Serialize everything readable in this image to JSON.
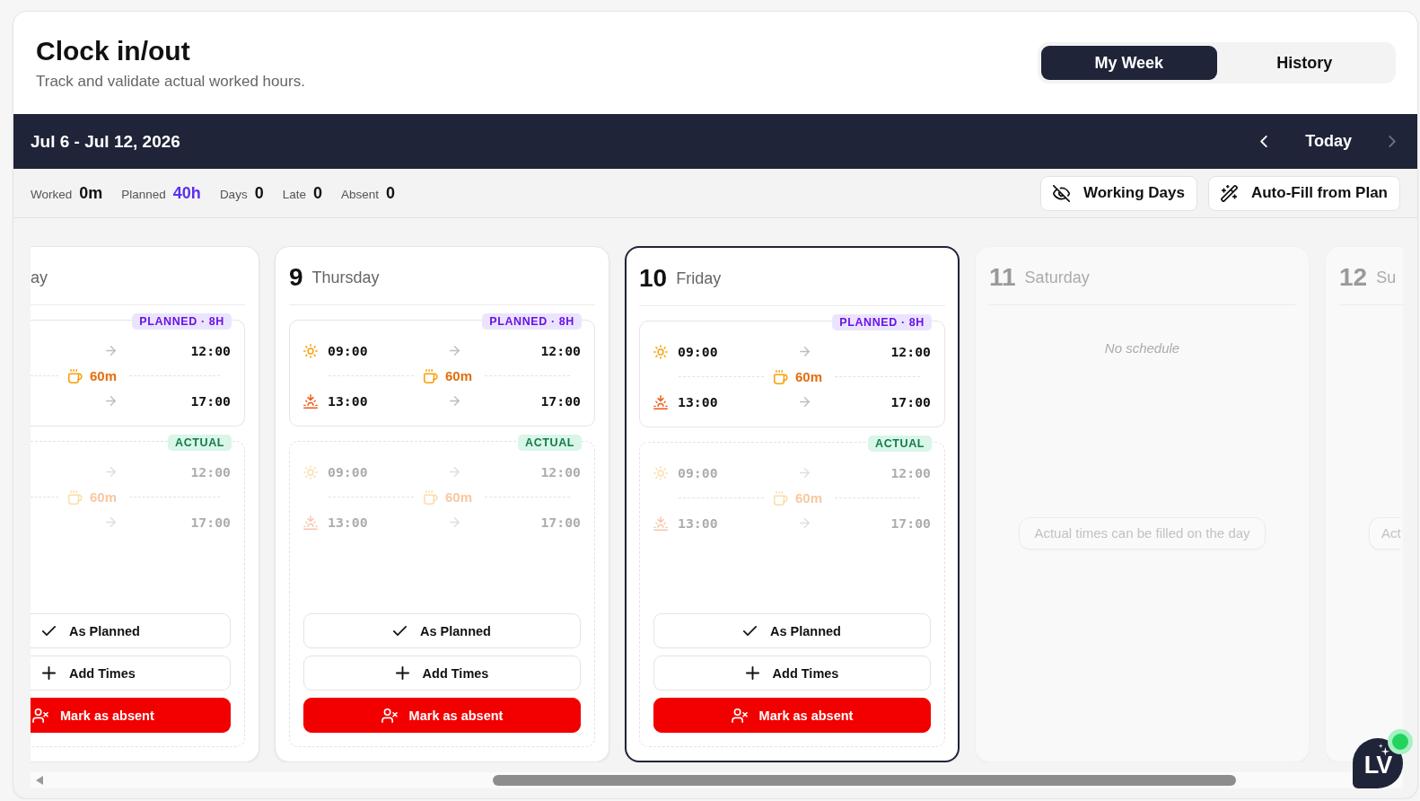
{
  "header": {
    "title": "Clock in/out",
    "subtitle": "Track and validate actual worked hours."
  },
  "tabs": [
    {
      "label": "My Week",
      "selected": true
    },
    {
      "label": "History",
      "selected": false
    }
  ],
  "week_bar": {
    "range": "Jul 6 - Jul 12, 2026",
    "prev": {
      "disabled": false
    },
    "today": "Today",
    "next": {
      "disabled": true
    }
  },
  "stats": [
    {
      "label": "Worked",
      "value": "0m",
      "highlighted": false
    },
    {
      "label": "Planned",
      "value": "40h",
      "highlighted": true
    },
    {
      "label": "Days",
      "value": "0",
      "highlighted": false
    },
    {
      "label": "Late",
      "value": "0",
      "highlighted": false
    },
    {
      "label": "Absent",
      "value": "0",
      "highlighted": false
    }
  ],
  "actions": [
    {
      "kind": "working-days",
      "label": "Working Days"
    },
    {
      "kind": "auto-fill",
      "label": "Auto-Fill from Plan"
    }
  ],
  "days": [
    {
      "kind": "workday",
      "cut_left": true,
      "cut_right": false,
      "selected": false,
      "day_name": "ay",
      "planned": {
        "badge": "PLANNED · 8H",
        "rows": [
          {
            "kind": "morning",
            "end": "12:00"
          },
          {
            "kind": "break",
            "duration": "60m"
          },
          {
            "kind": "afternoon",
            "end": "17:00"
          }
        ]
      },
      "actual": {
        "badge": "ACTUAL",
        "filled": false,
        "rows": [
          {
            "kind": "morning",
            "end": "12:00"
          },
          {
            "kind": "break",
            "duration": "60m"
          },
          {
            "kind": "afternoon",
            "end": "17:00"
          }
        ]
      },
      "buttons": [
        {
          "kind": "as-planned",
          "label": "As Planned"
        },
        {
          "kind": "add-times",
          "label": "Add Times"
        },
        {
          "kind": "mark-absent",
          "label": "Mark as absent"
        }
      ]
    },
    {
      "kind": "workday",
      "cut_left": false,
      "cut_right": false,
      "selected": false,
      "day_number": "9",
      "day_name": "Thursday",
      "planned": {
        "badge": "PLANNED · 8H",
        "rows": [
          {
            "kind": "morning",
            "start": "09:00",
            "end": "12:00"
          },
          {
            "kind": "break",
            "duration": "60m"
          },
          {
            "kind": "afternoon",
            "start": "13:00",
            "end": "17:00"
          }
        ]
      },
      "actual": {
        "badge": "ACTUAL",
        "filled": false,
        "rows": [
          {
            "kind": "morning",
            "start": "09:00",
            "end": "12:00"
          },
          {
            "kind": "break",
            "duration": "60m"
          },
          {
            "kind": "afternoon",
            "start": "13:00",
            "end": "17:00"
          }
        ]
      },
      "buttons": [
        {
          "kind": "as-planned",
          "label": "As Planned"
        },
        {
          "kind": "add-times",
          "label": "Add Times"
        },
        {
          "kind": "mark-absent",
          "label": "Mark as absent"
        }
      ]
    },
    {
      "kind": "workday",
      "cut_left": false,
      "cut_right": false,
      "selected": true,
      "day_number": "10",
      "day_name": "Friday",
      "planned": {
        "badge": "PLANNED · 8H",
        "rows": [
          {
            "kind": "morning",
            "start": "09:00",
            "end": "12:00"
          },
          {
            "kind": "break",
            "duration": "60m"
          },
          {
            "kind": "afternoon",
            "start": "13:00",
            "end": "17:00"
          }
        ]
      },
      "actual": {
        "badge": "ACTUAL",
        "filled": false,
        "rows": [
          {
            "kind": "morning",
            "start": "09:00",
            "end": "12:00"
          },
          {
            "kind": "break",
            "duration": "60m"
          },
          {
            "kind": "afternoon",
            "start": "13:00",
            "end": "17:00"
          }
        ]
      },
      "buttons": [
        {
          "kind": "as-planned",
          "label": "As Planned"
        },
        {
          "kind": "add-times",
          "label": "Add Times"
        },
        {
          "kind": "mark-absent",
          "label": "Mark as absent"
        }
      ]
    },
    {
      "kind": "weekend",
      "cut_left": false,
      "cut_right": false,
      "selected": false,
      "day_number": "11",
      "day_name": "Saturday",
      "note": "No schedule",
      "hint": "Actual times can be filled on the day"
    },
    {
      "kind": "weekend",
      "cut_left": false,
      "cut_right": true,
      "selected": false,
      "day_number": "12",
      "day_name": "Su",
      "hint": "Act"
    }
  ],
  "chat_widget": {
    "initials": "LV",
    "online": true
  }
}
